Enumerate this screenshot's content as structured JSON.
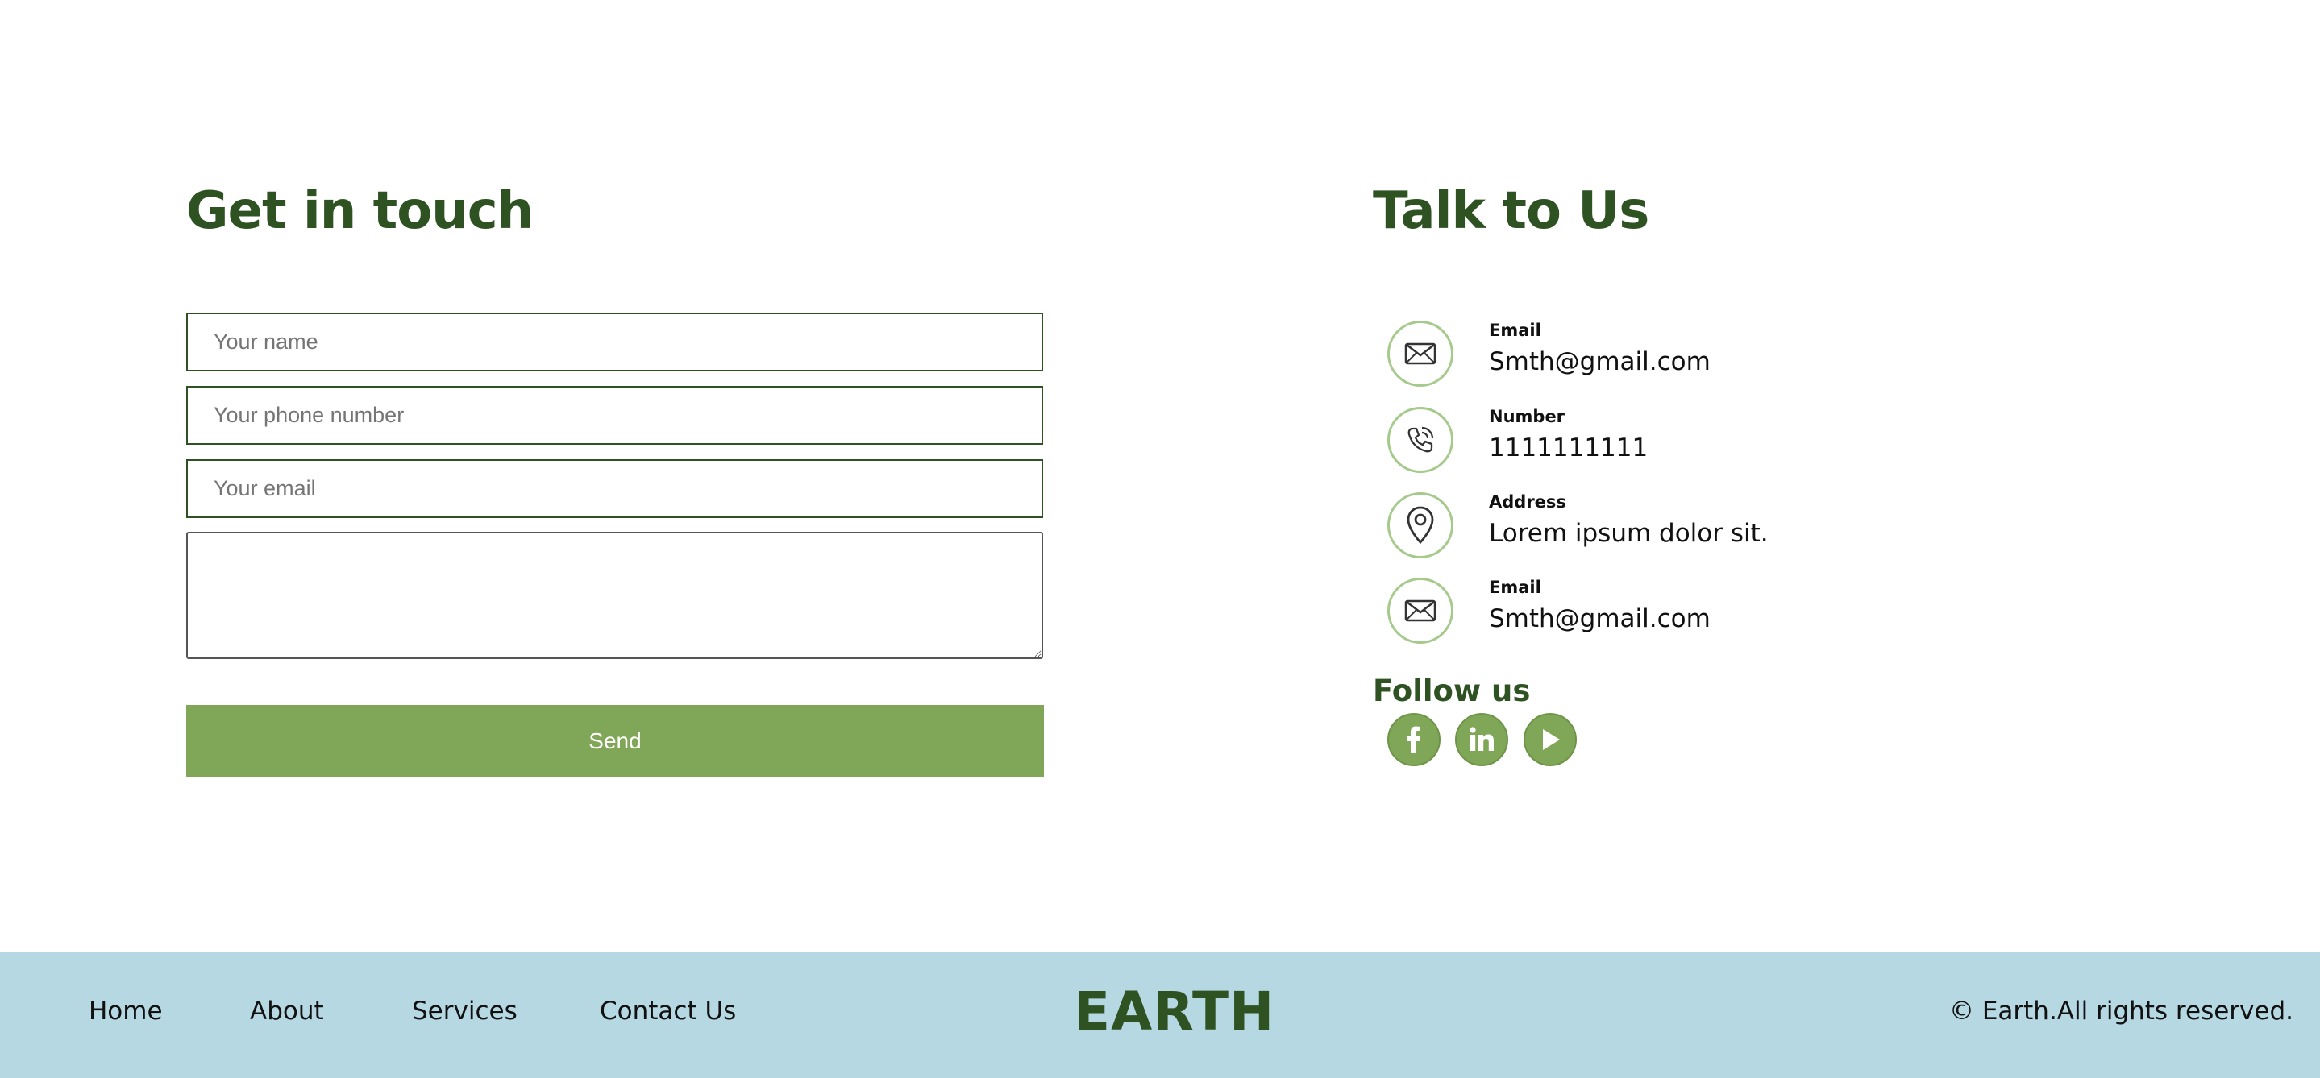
{
  "form": {
    "title": "Get in touch",
    "name_placeholder": "Your name",
    "phone_placeholder": "Your phone number",
    "email_placeholder": "Your email",
    "message_placeholder": "",
    "send_label": "Send"
  },
  "contact": {
    "title": "Talk to Us",
    "items": [
      {
        "label": "Email",
        "value": "Smth@gmail.com",
        "icon": "envelope-icon"
      },
      {
        "label": "Number",
        "value": "1111111111",
        "icon": "phone-icon"
      },
      {
        "label": "Address",
        "value": "Lorem ipsum dolor sit.",
        "icon": "location-pin-icon"
      },
      {
        "label": "Email",
        "value": "Smth@gmail.com",
        "icon": "envelope-icon"
      }
    ]
  },
  "follow": {
    "title": "Follow us",
    "socials": [
      "facebook-icon",
      "linkedin-icon",
      "youtube-icon"
    ]
  },
  "footer": {
    "nav": [
      "Home",
      "About",
      "Services",
      "Contact Us"
    ],
    "logo": "EARTH",
    "copyright": "© Earth.All rights reserved."
  },
  "colors": {
    "accent_green": "#80a757",
    "dark_green": "#2f5223",
    "icon_ring": "#a6c98c",
    "footer_bg": "#b6d8e3"
  }
}
